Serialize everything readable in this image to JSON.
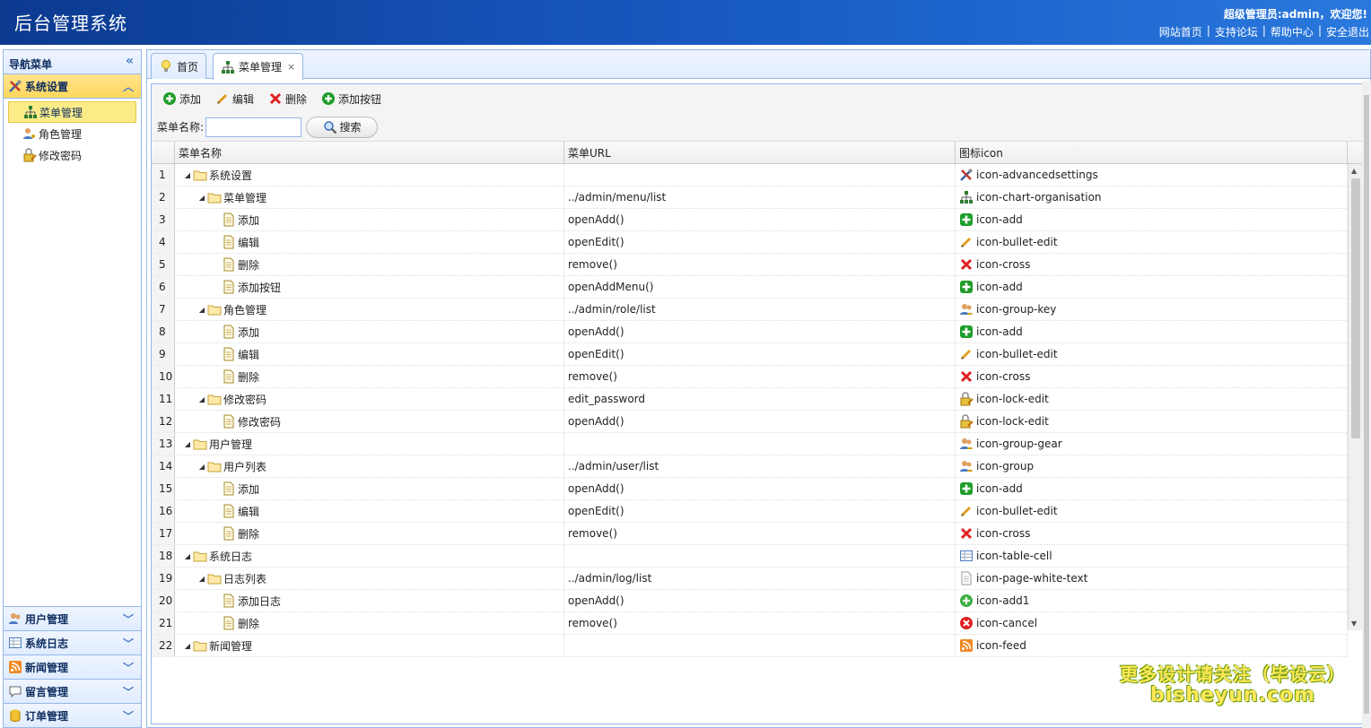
{
  "header": {
    "title": "后台管理系统",
    "welcome": "超级管理员:admin，欢迎您!",
    "links": [
      "网站首页",
      "支持论坛",
      "帮助中心",
      "安全退出"
    ],
    "sep": "|"
  },
  "sidebar": {
    "title": "导航菜单",
    "collapse_glyph": "«",
    "active_group": {
      "label": "系统设置",
      "icon": "advancedsettings-icon"
    },
    "items": [
      {
        "label": "菜单管理",
        "icon": "chart-organisation-icon",
        "selected": true
      },
      {
        "label": "角色管理",
        "icon": "group-key-icon",
        "selected": false
      },
      {
        "label": "修改密码",
        "icon": "lock-edit-icon",
        "selected": false
      }
    ],
    "groups": [
      {
        "label": "用户管理",
        "icon": "group-icon"
      },
      {
        "label": "系统日志",
        "icon": "table-cell-icon"
      },
      {
        "label": "新闻管理",
        "icon": "feed-icon"
      },
      {
        "label": "留言管理",
        "icon": "comment-icon"
      },
      {
        "label": "订单管理",
        "icon": "database-icon"
      }
    ]
  },
  "tabs": [
    {
      "label": "首页",
      "icon": "lightbulb-icon",
      "active": false
    },
    {
      "label": "菜单管理",
      "icon": "chart-organisation-icon",
      "active": true,
      "close": "×"
    }
  ],
  "toolbar": {
    "add": "添加",
    "edit": "编辑",
    "remove": "删除",
    "add_button": "添加按钮"
  },
  "search": {
    "label": "菜单名称:",
    "value": "",
    "button": "搜索"
  },
  "grid": {
    "headers": [
      "菜单名称",
      "菜单URL",
      "图标icon"
    ],
    "rows": [
      {
        "n": "1",
        "level": 0,
        "type": "folder",
        "name": "系统设置",
        "url": "",
        "icon": "icon-advancedsettings",
        "glyph": "tools"
      },
      {
        "n": "2",
        "level": 1,
        "type": "folder",
        "name": "菜单管理",
        "url": "../admin/menu/list",
        "icon": "icon-chart-organisation",
        "glyph": "org"
      },
      {
        "n": "3",
        "level": 2,
        "type": "file",
        "name": "添加",
        "url": "openAdd()",
        "icon": "icon-add",
        "glyph": "add"
      },
      {
        "n": "4",
        "level": 2,
        "type": "file",
        "name": "编辑",
        "url": "openEdit()",
        "icon": "icon-bullet-edit",
        "glyph": "edit"
      },
      {
        "n": "5",
        "level": 2,
        "type": "file",
        "name": "删除",
        "url": "remove()",
        "icon": "icon-cross",
        "glyph": "cross"
      },
      {
        "n": "6",
        "level": 2,
        "type": "file",
        "name": "添加按钮",
        "url": "openAddMenu()",
        "icon": "icon-add",
        "glyph": "add"
      },
      {
        "n": "7",
        "level": 1,
        "type": "folder",
        "name": "角色管理",
        "url": "../admin/role/list",
        "icon": "icon-group-key",
        "glyph": "group"
      },
      {
        "n": "8",
        "level": 2,
        "type": "file",
        "name": "添加",
        "url": "openAdd()",
        "icon": "icon-add",
        "glyph": "add"
      },
      {
        "n": "9",
        "level": 2,
        "type": "file",
        "name": "编辑",
        "url": "openEdit()",
        "icon": "icon-bullet-edit",
        "glyph": "edit"
      },
      {
        "n": "10",
        "level": 2,
        "type": "file",
        "name": "删除",
        "url": "remove()",
        "icon": "icon-cross",
        "glyph": "cross"
      },
      {
        "n": "11",
        "level": 1,
        "type": "folder",
        "name": "修改密码",
        "url": "edit_password",
        "icon": "icon-lock-edit",
        "glyph": "lock"
      },
      {
        "n": "12",
        "level": 2,
        "type": "file",
        "name": "修改密码",
        "url": "openAdd()",
        "icon": "icon-lock-edit",
        "glyph": "lock"
      },
      {
        "n": "13",
        "level": 0,
        "type": "folder",
        "name": "用户管理",
        "url": "",
        "icon": "icon-group-gear",
        "glyph": "group"
      },
      {
        "n": "14",
        "level": 1,
        "type": "folder",
        "name": "用户列表",
        "url": "../admin/user/list",
        "icon": "icon-group",
        "glyph": "group"
      },
      {
        "n": "15",
        "level": 2,
        "type": "file",
        "name": "添加",
        "url": "openAdd()",
        "icon": "icon-add",
        "glyph": "add"
      },
      {
        "n": "16",
        "level": 2,
        "type": "file",
        "name": "编辑",
        "url": "openEdit()",
        "icon": "icon-bullet-edit",
        "glyph": "edit"
      },
      {
        "n": "17",
        "level": 2,
        "type": "file",
        "name": "删除",
        "url": "remove()",
        "icon": "icon-cross",
        "glyph": "cross"
      },
      {
        "n": "18",
        "level": 0,
        "type": "folder",
        "name": "系统日志",
        "url": "",
        "icon": "icon-table-cell",
        "glyph": "table"
      },
      {
        "n": "19",
        "level": 1,
        "type": "folder",
        "name": "日志列表",
        "url": "../admin/log/list",
        "icon": "icon-page-white-text",
        "glyph": "page"
      },
      {
        "n": "20",
        "level": 2,
        "type": "file",
        "name": "添加日志",
        "url": "openAdd()",
        "icon": "icon-add1",
        "glyph": "add1"
      },
      {
        "n": "21",
        "level": 2,
        "type": "file",
        "name": "删除",
        "url": "remove()",
        "icon": "icon-cancel",
        "glyph": "cancel"
      },
      {
        "n": "22",
        "level": 0,
        "type": "folder",
        "name": "新闻管理",
        "url": "",
        "icon": "icon-feed",
        "glyph": "feed"
      }
    ]
  },
  "watermark": {
    "line1": "更多设计请关注（毕设云）",
    "line2": "bisheyun.com"
  },
  "colors": {
    "header_bg": "#1553b8",
    "panel_border": "#95b8e7",
    "selected_bg": "#fbec88",
    "add_green": "#1f9d2a",
    "cross_red": "#e02020"
  }
}
